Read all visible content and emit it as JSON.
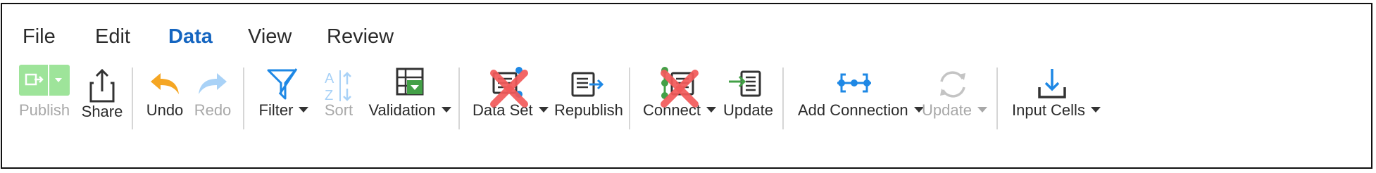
{
  "menu": {
    "items": [
      "File",
      "Edit",
      "Data",
      "View",
      "Review"
    ],
    "active": "Data"
  },
  "toolbar": {
    "publish": "Publish",
    "share": "Share",
    "undo": "Undo",
    "redo": "Redo",
    "filter": "Filter",
    "sort": "Sort",
    "validation": "Validation",
    "data_set": "Data Set",
    "republish": "Republish",
    "connect": "Connect",
    "update": "Update",
    "add_connection": "Add Connection",
    "update_connection": "Update",
    "input_cells": "Input Cells"
  },
  "colors": {
    "accent": "#1565c0",
    "icon_blue": "#1e88e5",
    "green": "#43a047",
    "publish_green": "#9ee49a",
    "undo_orange": "#f5a623",
    "disabled": "#a8a8a8",
    "red_x": "#f25a5a"
  }
}
